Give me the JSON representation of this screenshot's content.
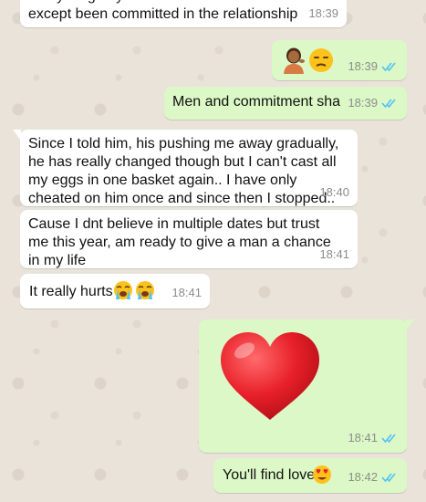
{
  "messages": [
    {
      "side": "in",
      "text": "everything any man can do for a woman except been committed in the relationship",
      "time": "18:39"
    },
    {
      "side": "out",
      "emoji": [
        "person-tipping-hand-emoji",
        "unamused-face-emoji"
      ],
      "time": "18:39",
      "status": "read"
    },
    {
      "side": "out",
      "text": "Men and commitment sha",
      "time": "18:39",
      "status": "read"
    },
    {
      "side": "in",
      "text": "Since I told him, his pushing me away gradually, he has really changed though but I can't cast all my eggs in one basket again.. I have only cheated on him once and since then I stopped..",
      "time": "18:40"
    },
    {
      "side": "in",
      "text": "Cause I dnt believe in multiple dates but trust me this year, am ready to give a man a chance in my life",
      "time": "18:41"
    },
    {
      "side": "in",
      "text": "It really hurts",
      "emoji": [
        "loudly-crying-face-emoji",
        "loudly-crying-face-emoji"
      ],
      "time": "18:41"
    },
    {
      "side": "out",
      "emoji": [
        "red-heart-emoji"
      ],
      "time": "18:41",
      "status": "read"
    },
    {
      "side": "out",
      "text": "You'll find love",
      "emoji": [
        "heart-eyes-emoji"
      ],
      "time": "18:42",
      "status": "read"
    }
  ],
  "colors": {
    "incoming": "#ffffff",
    "outgoing": "#dcf8c6",
    "read_ticks": "#4fc3f7",
    "timestamp": "#8c8c8c",
    "wallpaper": "#ece5dd"
  }
}
